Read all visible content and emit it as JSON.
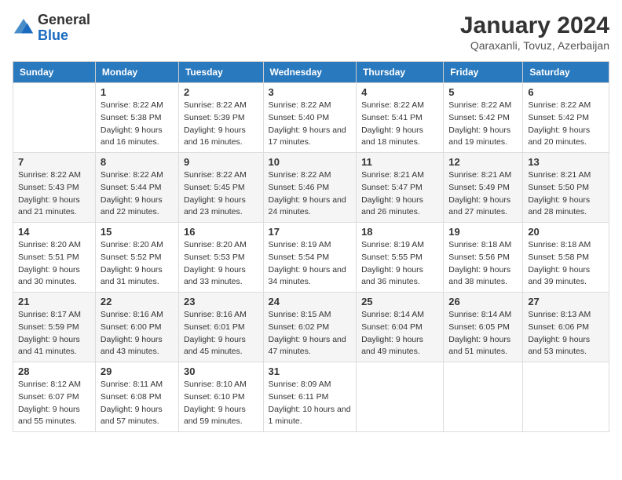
{
  "logo": {
    "general": "General",
    "blue": "Blue",
    "icon_title": "GeneralBlue logo"
  },
  "title": "January 2024",
  "subtitle": "Qaraxanli, Tovuz, Azerbaijan",
  "days_of_week": [
    "Sunday",
    "Monday",
    "Tuesday",
    "Wednesday",
    "Thursday",
    "Friday",
    "Saturday"
  ],
  "weeks": [
    [
      {
        "day": "",
        "sunrise": "",
        "sunset": "",
        "daylight": ""
      },
      {
        "day": "1",
        "sunrise": "Sunrise: 8:22 AM",
        "sunset": "Sunset: 5:38 PM",
        "daylight": "Daylight: 9 hours and 16 minutes."
      },
      {
        "day": "2",
        "sunrise": "Sunrise: 8:22 AM",
        "sunset": "Sunset: 5:39 PM",
        "daylight": "Daylight: 9 hours and 16 minutes."
      },
      {
        "day": "3",
        "sunrise": "Sunrise: 8:22 AM",
        "sunset": "Sunset: 5:40 PM",
        "daylight": "Daylight: 9 hours and 17 minutes."
      },
      {
        "day": "4",
        "sunrise": "Sunrise: 8:22 AM",
        "sunset": "Sunset: 5:41 PM",
        "daylight": "Daylight: 9 hours and 18 minutes."
      },
      {
        "day": "5",
        "sunrise": "Sunrise: 8:22 AM",
        "sunset": "Sunset: 5:42 PM",
        "daylight": "Daylight: 9 hours and 19 minutes."
      },
      {
        "day": "6",
        "sunrise": "Sunrise: 8:22 AM",
        "sunset": "Sunset: 5:42 PM",
        "daylight": "Daylight: 9 hours and 20 minutes."
      }
    ],
    [
      {
        "day": "7",
        "sunrise": "Sunrise: 8:22 AM",
        "sunset": "Sunset: 5:43 PM",
        "daylight": "Daylight: 9 hours and 21 minutes."
      },
      {
        "day": "8",
        "sunrise": "Sunrise: 8:22 AM",
        "sunset": "Sunset: 5:44 PM",
        "daylight": "Daylight: 9 hours and 22 minutes."
      },
      {
        "day": "9",
        "sunrise": "Sunrise: 8:22 AM",
        "sunset": "Sunset: 5:45 PM",
        "daylight": "Daylight: 9 hours and 23 minutes."
      },
      {
        "day": "10",
        "sunrise": "Sunrise: 8:22 AM",
        "sunset": "Sunset: 5:46 PM",
        "daylight": "Daylight: 9 hours and 24 minutes."
      },
      {
        "day": "11",
        "sunrise": "Sunrise: 8:21 AM",
        "sunset": "Sunset: 5:47 PM",
        "daylight": "Daylight: 9 hours and 26 minutes."
      },
      {
        "day": "12",
        "sunrise": "Sunrise: 8:21 AM",
        "sunset": "Sunset: 5:49 PM",
        "daylight": "Daylight: 9 hours and 27 minutes."
      },
      {
        "day": "13",
        "sunrise": "Sunrise: 8:21 AM",
        "sunset": "Sunset: 5:50 PM",
        "daylight": "Daylight: 9 hours and 28 minutes."
      }
    ],
    [
      {
        "day": "14",
        "sunrise": "Sunrise: 8:20 AM",
        "sunset": "Sunset: 5:51 PM",
        "daylight": "Daylight: 9 hours and 30 minutes."
      },
      {
        "day": "15",
        "sunrise": "Sunrise: 8:20 AM",
        "sunset": "Sunset: 5:52 PM",
        "daylight": "Daylight: 9 hours and 31 minutes."
      },
      {
        "day": "16",
        "sunrise": "Sunrise: 8:20 AM",
        "sunset": "Sunset: 5:53 PM",
        "daylight": "Daylight: 9 hours and 33 minutes."
      },
      {
        "day": "17",
        "sunrise": "Sunrise: 8:19 AM",
        "sunset": "Sunset: 5:54 PM",
        "daylight": "Daylight: 9 hours and 34 minutes."
      },
      {
        "day": "18",
        "sunrise": "Sunrise: 8:19 AM",
        "sunset": "Sunset: 5:55 PM",
        "daylight": "Daylight: 9 hours and 36 minutes."
      },
      {
        "day": "19",
        "sunrise": "Sunrise: 8:18 AM",
        "sunset": "Sunset: 5:56 PM",
        "daylight": "Daylight: 9 hours and 38 minutes."
      },
      {
        "day": "20",
        "sunrise": "Sunrise: 8:18 AM",
        "sunset": "Sunset: 5:58 PM",
        "daylight": "Daylight: 9 hours and 39 minutes."
      }
    ],
    [
      {
        "day": "21",
        "sunrise": "Sunrise: 8:17 AM",
        "sunset": "Sunset: 5:59 PM",
        "daylight": "Daylight: 9 hours and 41 minutes."
      },
      {
        "day": "22",
        "sunrise": "Sunrise: 8:16 AM",
        "sunset": "Sunset: 6:00 PM",
        "daylight": "Daylight: 9 hours and 43 minutes."
      },
      {
        "day": "23",
        "sunrise": "Sunrise: 8:16 AM",
        "sunset": "Sunset: 6:01 PM",
        "daylight": "Daylight: 9 hours and 45 minutes."
      },
      {
        "day": "24",
        "sunrise": "Sunrise: 8:15 AM",
        "sunset": "Sunset: 6:02 PM",
        "daylight": "Daylight: 9 hours and 47 minutes."
      },
      {
        "day": "25",
        "sunrise": "Sunrise: 8:14 AM",
        "sunset": "Sunset: 6:04 PM",
        "daylight": "Daylight: 9 hours and 49 minutes."
      },
      {
        "day": "26",
        "sunrise": "Sunrise: 8:14 AM",
        "sunset": "Sunset: 6:05 PM",
        "daylight": "Daylight: 9 hours and 51 minutes."
      },
      {
        "day": "27",
        "sunrise": "Sunrise: 8:13 AM",
        "sunset": "Sunset: 6:06 PM",
        "daylight": "Daylight: 9 hours and 53 minutes."
      }
    ],
    [
      {
        "day": "28",
        "sunrise": "Sunrise: 8:12 AM",
        "sunset": "Sunset: 6:07 PM",
        "daylight": "Daylight: 9 hours and 55 minutes."
      },
      {
        "day": "29",
        "sunrise": "Sunrise: 8:11 AM",
        "sunset": "Sunset: 6:08 PM",
        "daylight": "Daylight: 9 hours and 57 minutes."
      },
      {
        "day": "30",
        "sunrise": "Sunrise: 8:10 AM",
        "sunset": "Sunset: 6:10 PM",
        "daylight": "Daylight: 9 hours and 59 minutes."
      },
      {
        "day": "31",
        "sunrise": "Sunrise: 8:09 AM",
        "sunset": "Sunset: 6:11 PM",
        "daylight": "Daylight: 10 hours and 1 minute."
      },
      {
        "day": "",
        "sunrise": "",
        "sunset": "",
        "daylight": ""
      },
      {
        "day": "",
        "sunrise": "",
        "sunset": "",
        "daylight": ""
      },
      {
        "day": "",
        "sunrise": "",
        "sunset": "",
        "daylight": ""
      }
    ]
  ]
}
